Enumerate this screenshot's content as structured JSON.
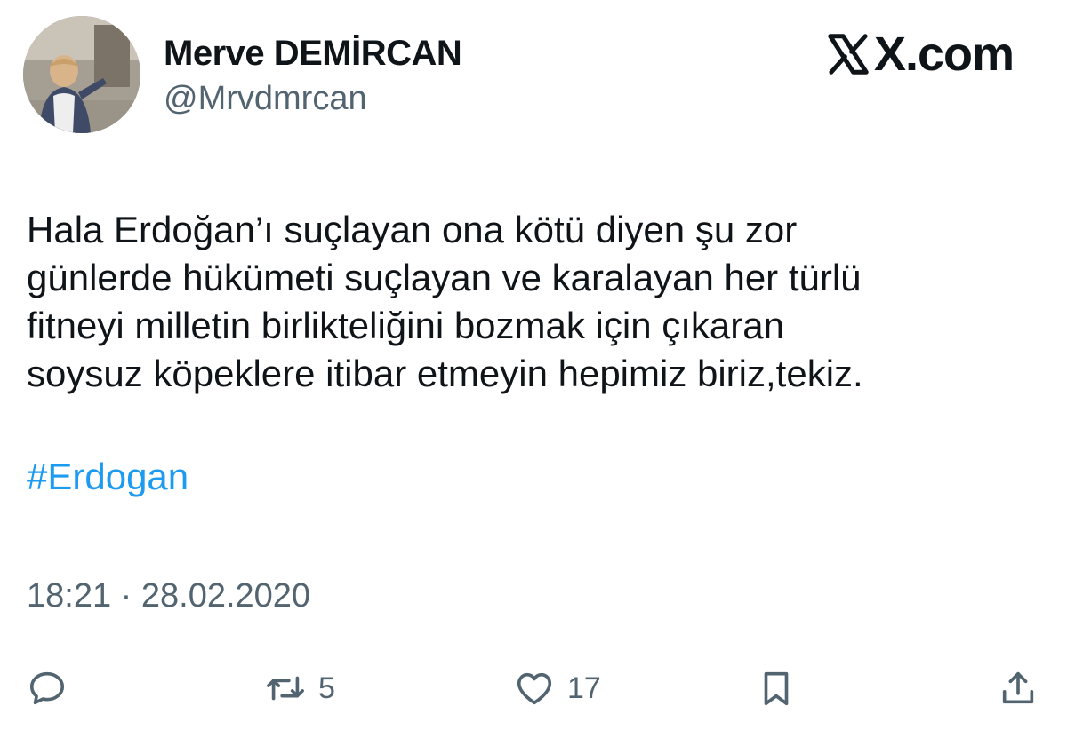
{
  "author": {
    "display_name": "Merve DEMİRCAN",
    "handle": "@Mrvdmrcan"
  },
  "brand": {
    "label": "X.com"
  },
  "tweet": {
    "text": "Hala Erdoğan’ı suçlayan ona kötü diyen şu zor\ngünlerde hükümeti suçlayan ve karalayan her türlü\nfitneyi milletin birlikteliğini bozmak için çıkaran\nsoysuz köpeklere itibar etmeyin hepimiz biriz,tekiz.",
    "hashtag": "#Erdogan",
    "timestamp": "18:21 · 28.02.2020"
  },
  "actions": {
    "reply": {
      "icon": "reply-icon"
    },
    "retweet": {
      "icon": "retweet-icon",
      "count": "5"
    },
    "like": {
      "icon": "heart-icon",
      "count": "17"
    },
    "bookmark": {
      "icon": "bookmark-icon"
    },
    "share": {
      "icon": "share-icon"
    }
  },
  "colors": {
    "text": "#0f1419",
    "secondary": "#536471",
    "link": "#1d9bf0",
    "background": "#ffffff"
  }
}
